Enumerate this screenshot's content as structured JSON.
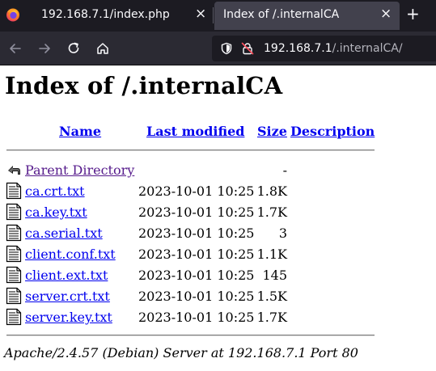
{
  "browser": {
    "tabs": [
      {
        "title": "192.168.7.1/index.php",
        "active": false
      },
      {
        "title": "Index of /.internalCA",
        "active": true
      }
    ],
    "new_tab_label": "+",
    "close_label": "×",
    "url": {
      "host": "192.168.7.1",
      "path": "/.internalCA/"
    },
    "icons": [
      "firefox-logo",
      "back-arrow",
      "forward-arrow",
      "reload",
      "home",
      "shield",
      "insecure-lock"
    ]
  },
  "page": {
    "title": "Index of /.internalCA",
    "columns": {
      "name": "Name",
      "last_modified": "Last modified",
      "size": "Size",
      "description": "Description"
    },
    "parent": {
      "name": "Parent Directory",
      "size": "-"
    },
    "files": [
      {
        "name": "ca.crt.txt",
        "date": "2023-10-01 10:25",
        "size": "1.8K"
      },
      {
        "name": "ca.key.txt",
        "date": "2023-10-01 10:25",
        "size": "1.7K"
      },
      {
        "name": "ca.serial.txt",
        "date": "2023-10-01 10:25",
        "size": "3"
      },
      {
        "name": "client.conf.txt",
        "date": "2023-10-01 10:25",
        "size": "1.1K"
      },
      {
        "name": "client.ext.txt",
        "date": "2023-10-01 10:25",
        "size": "145"
      },
      {
        "name": "server.crt.txt",
        "date": "2023-10-01 10:25",
        "size": "1.5K"
      },
      {
        "name": "server.key.txt",
        "date": "2023-10-01 10:25",
        "size": "1.7K"
      }
    ],
    "footer": "Apache/2.4.57 (Debian) Server at 192.168.7.1 Port 80"
  },
  "colors": {
    "link": "#0000ee",
    "visited": "#551a8b",
    "tabbar": "#1c1b22",
    "toolbar": "#2b2a33"
  }
}
